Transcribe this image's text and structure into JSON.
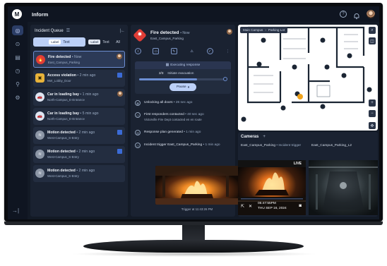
{
  "app": {
    "logo": "M",
    "title": "Inform"
  },
  "topbar": {
    "help_icon": "?",
    "bell_icon": "🔔"
  },
  "rail": {
    "items": [
      "headset-icon",
      "radio-icon",
      "map-icon",
      "clock-icon",
      "signal-icon",
      "settings-icon"
    ],
    "collapse_icon": "→|"
  },
  "queue": {
    "title": "Incident Queue",
    "tabs": [
      {
        "chip": "Label",
        "label": "Text"
      },
      {
        "chip": "Label",
        "label": "Text"
      },
      {
        "label": "All"
      }
    ],
    "items": [
      {
        "title": "Fire detected",
        "time": "• Now",
        "location": "East_Campus_Parking",
        "icon": "🔥",
        "icon_bg": "#e03d36",
        "selected": true
      },
      {
        "title": "Access violation",
        "time": "• 2 min ago",
        "location": "NW_Lobby_Door",
        "icon": "▣",
        "icon_bg": "#e8b33a",
        "selected": false
      },
      {
        "title": "Car in loading bay",
        "time": "• 1 min ago",
        "location": "North-Campus_E-Entrance",
        "icon": "🚗",
        "icon_bg": "#dfe6f3",
        "selected": false
      },
      {
        "title": "Car in loading bay",
        "time": "• 5 min ago",
        "location": "North-Campus_E-Entrance",
        "icon": "🚗",
        "icon_bg": "#dfe6f3",
        "selected": false
      },
      {
        "title": "Motion detected",
        "time": "• 2 min ago",
        "location": "West-Campus_S-Entry",
        "icon": "≋",
        "icon_bg": "#8c96a6",
        "selected": false
      },
      {
        "title": "Motion detected",
        "time": "• 2 min ago",
        "location": "West-Campus_S-Entry",
        "icon": "≋",
        "icon_bg": "#8c96a6",
        "selected": false
      },
      {
        "title": "Motion detected",
        "time": "• 2 min ago",
        "location": "West-Campus_S-Entry",
        "icon": "≋",
        "icon_bg": "#8c96a6",
        "selected": false
      }
    ]
  },
  "detail": {
    "title": "Fire detected",
    "time": "• Now",
    "location": "East_Campus_Parking",
    "response": {
      "header": "Executing response",
      "step": "2/3",
      "step_label": "Initiate evacuation",
      "progress": 0.66,
      "pause_label": "Pause"
    },
    "timeline": [
      {
        "text": "Unlocking all doors",
        "time": "• 26 sec ago",
        "sub": ""
      },
      {
        "text": "First responders contacted",
        "time": "• 40 sec ago",
        "sub": "Victorville Fire Dept contacted en en route"
      },
      {
        "text": "Response plan generated",
        "time": "• 1 min ago",
        "sub": ""
      },
      {
        "text": "Incident trigger East_Campus_Parking",
        "time": "• 1 min ago",
        "sub": ""
      }
    ],
    "photo_caption": "Trigger at 11:43:26 PM"
  },
  "map": {
    "breadcrumb": [
      "Main Campus",
      "Parking Lot"
    ],
    "controls": {
      "search": "⌕",
      "layers": "◫",
      "zoom_in": "+",
      "zoom_out": "−",
      "recenter": "✥"
    }
  },
  "cameras": {
    "title": "Cameras",
    "add": "+",
    "feeds": [
      {
        "label": "East_Campus_Parking",
        "tag": "• Incident trigger",
        "live": "LIVE",
        "time": "05:47:55PM",
        "date": "THU SEP 16, 2024"
      },
      {
        "label": "East_Campus_Parking_L2"
      }
    ]
  }
}
